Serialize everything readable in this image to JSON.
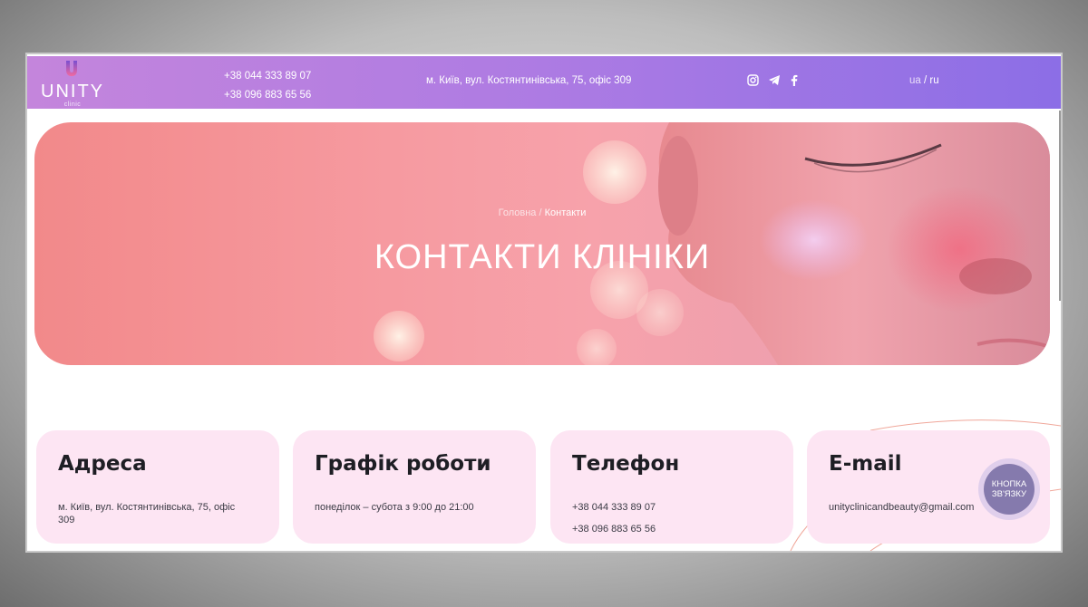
{
  "header": {
    "logo": {
      "name": "UNITY",
      "sub": "clinic"
    },
    "phones": [
      "+38 044 333 89 07",
      "+38 096 883 65 56"
    ],
    "address": "м. Київ, вул. Костянтинівська, 75, офіс 309",
    "socials": [
      "instagram-icon",
      "telegram-icon",
      "facebook-icon"
    ],
    "lang": {
      "ua": "ua",
      "sep": "/",
      "ru": "ru"
    }
  },
  "hero": {
    "breadcrumb": {
      "home": "Головна",
      "sep": "/",
      "current": "Контакти"
    },
    "title": "КОНТАКТИ КЛІНІКИ"
  },
  "cards": [
    {
      "title": "Адреса",
      "lines": [
        "м. Київ, вул. Костянтинівська, 75, офіс",
        "309"
      ]
    },
    {
      "title": "Графік роботи",
      "lines": [
        "понеділок – субота з 9:00 до 21:00"
      ]
    },
    {
      "title": "Телефон",
      "lines": [
        "+38 044 333 89 07",
        "+38 096 883 65 56"
      ]
    },
    {
      "title": "E-mail",
      "lines": [
        "unityclinicandbeauty@gmail.com"
      ]
    }
  ],
  "fab": {
    "label_line1": "КНОПКА",
    "label_line2": "ЗВ'ЯЗКУ"
  },
  "colors": {
    "header_start": "#c485dc",
    "header_end": "#8c6ee6",
    "card_bg": "#fde5f3",
    "fab": "#786ea5"
  }
}
